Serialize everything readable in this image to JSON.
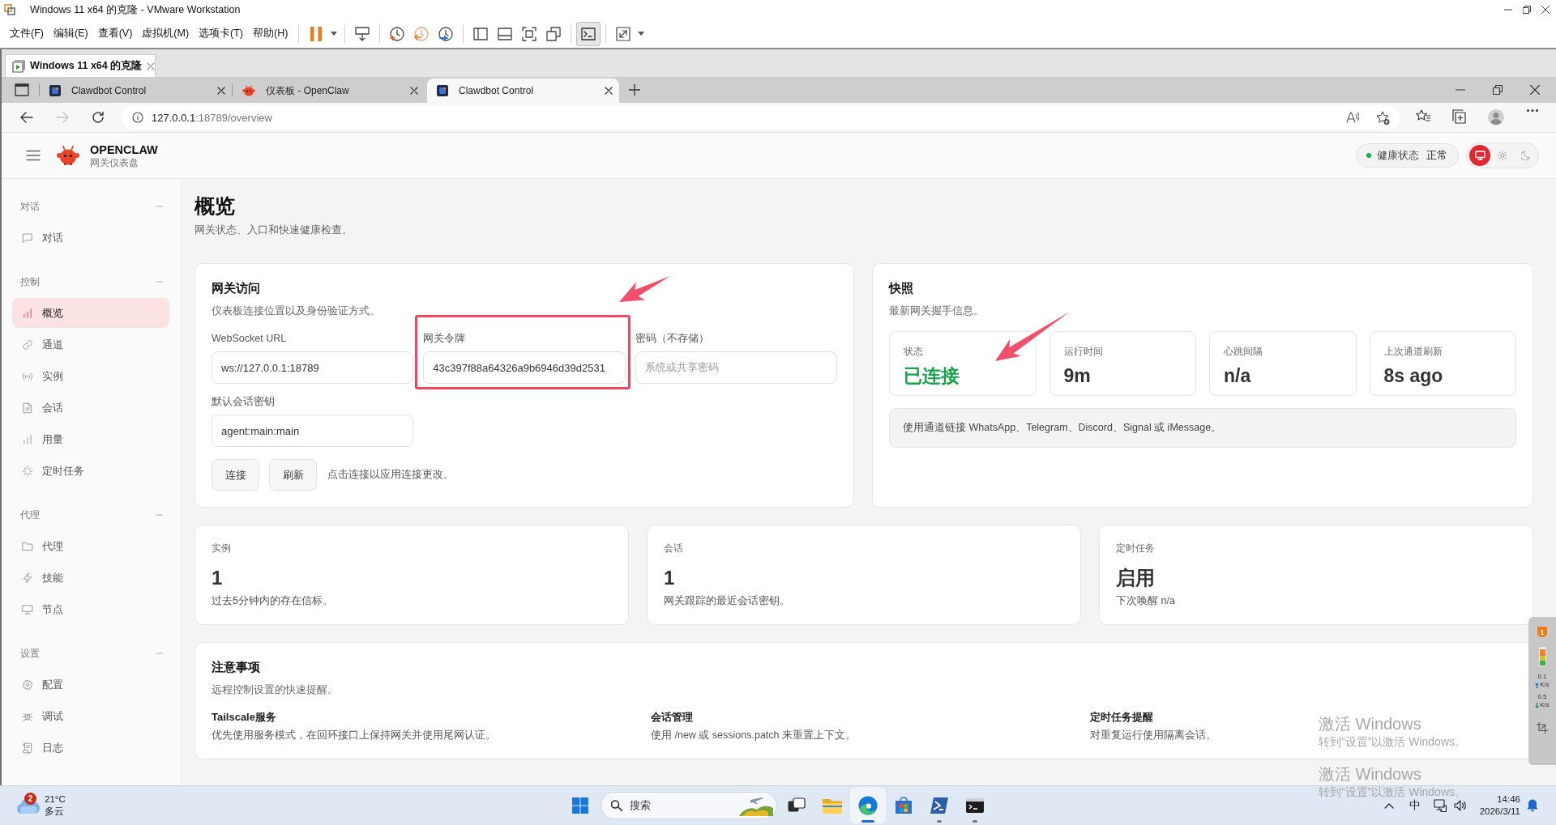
{
  "vmware": {
    "title": "Windows 11 x64 的克隆 - VMware Workstation",
    "menu": [
      "文件(F)",
      "编辑(E)",
      "查看(V)",
      "虚拟机(M)",
      "选项卡(T)",
      "帮助(H)"
    ],
    "console_pressed": true,
    "tabs": [
      {
        "label": "Windows 11 x64 的克隆",
        "selected": true
      }
    ]
  },
  "browser": {
    "tabs": [
      {
        "label": "Clawdbot Control",
        "kind": "tile",
        "selected": false
      },
      {
        "label": "仪表板 - OpenClaw",
        "kind": "mascot",
        "selected": false
      },
      {
        "label": "Clawdbot Control",
        "kind": "tile",
        "selected": true
      }
    ],
    "nav_buttons": [
      {
        "kind": "back",
        "disabled": false
      },
      {
        "kind": "forward",
        "disabled": true
      },
      {
        "kind": "refresh",
        "disabled": false
      }
    ],
    "address": {
      "host": "127.0.0.1",
      "path": ":18789/overview"
    }
  },
  "header": {
    "brand": "OPENCLAW",
    "subtitle": "网关仪表盘",
    "health": {
      "label": "健康状态",
      "value": "正常",
      "ok": true
    },
    "theme_modes": [
      {
        "kind": "system",
        "selected": true
      },
      {
        "kind": "light",
        "selected": false
      },
      {
        "kind": "dark",
        "selected": false
      }
    ]
  },
  "sidebar": {
    "sections": [
      {
        "title": "对话",
        "expanded": true,
        "items": [
          {
            "label": "对话",
            "selected": false
          }
        ]
      },
      {
        "title": "控制",
        "expanded": true,
        "items": [
          {
            "label": "概览",
            "selected": true
          },
          {
            "label": "通道",
            "selected": false
          },
          {
            "label": "实例",
            "selected": false
          },
          {
            "label": "会话",
            "selected": false
          },
          {
            "label": "用量",
            "selected": false
          },
          {
            "label": "定时任务",
            "selected": false
          }
        ]
      },
      {
        "title": "代理",
        "expanded": true,
        "items": [
          {
            "label": "代理",
            "selected": false
          },
          {
            "label": "技能",
            "selected": false
          },
          {
            "label": "节点",
            "selected": false
          }
        ]
      },
      {
        "title": "设置",
        "expanded": true,
        "items": [
          {
            "label": "配置",
            "selected": false
          },
          {
            "label": "调试",
            "selected": false
          },
          {
            "label": "日志",
            "selected": false
          }
        ]
      }
    ]
  },
  "page": {
    "title": "概览",
    "subtitle": "网关状态、入口和快速健康检查。"
  },
  "gateway_access": {
    "title": "网关访问",
    "description": "仪表板连接位置以及身份验证方式。",
    "fields": [
      {
        "label": "WebSocket URL",
        "value": "ws://127.0.0.1:18789",
        "highlighted": false,
        "arrow": false
      },
      {
        "label": "网关令牌",
        "value": "43c397f88a64326a9b6946d39d2531",
        "highlighted": true,
        "arrow": true
      },
      {
        "label": "密码（不存储）",
        "placeholder": "系统或共享密码",
        "highlighted": false,
        "arrow": false
      },
      {
        "label": "默认会话密钥",
        "value": "agent:main:main",
        "highlighted": false,
        "arrow": false
      }
    ],
    "buttons": [
      "连接",
      "刷新"
    ],
    "hint": "点击连接以应用连接更改。"
  },
  "snapshot": {
    "title": "快照",
    "description": "最新网关握手信息。",
    "stats": [
      {
        "kind": "status",
        "label": "状态",
        "value": "已连接",
        "arrow": true
      },
      {
        "kind": "metric",
        "label": "运行时间",
        "value": "9m",
        "arrow": false
      },
      {
        "kind": "metric",
        "label": "心跳间隔",
        "value": "n/a",
        "arrow": false
      },
      {
        "kind": "metric",
        "label": "上次通道刷新",
        "value": "8s ago",
        "arrow": false
      }
    ],
    "note": "使用通道链接 WhatsApp、Telegram、Discord、Signal 或 iMessage。"
  },
  "summary_cards": [
    {
      "label": "实例",
      "value": "1",
      "detail": "过去5分钟内的存在信标。"
    },
    {
      "label": "会话",
      "value": "1",
      "detail": "网关跟踪的最近会话密钥。"
    },
    {
      "label": "定时任务",
      "value": "启用",
      "detail": "下次唤醒 n/a"
    }
  ],
  "notes": {
    "title": "注意事项",
    "description": "远程控制设置的快速提醒。",
    "items": [
      {
        "title": "Tailscale服务",
        "text": "优先使用服务模式，在回环接口上保持网关并使用尾网认证。"
      },
      {
        "title": "会话管理",
        "text": "使用 /new 或 sessions.patch 来重置上下文。"
      },
      {
        "title": "定时任务提醒",
        "text": "对重复运行使用隔离会话。"
      }
    ]
  },
  "network_monitor": {
    "badge": "1",
    "upload": "0.1",
    "upload_unit": "K/s",
    "download": "0.5",
    "download_unit": "K/s"
  },
  "activation_notices": [
    {
      "title": "激活 Windows",
      "text": "转到“设置”以激活 Windows。"
    },
    {
      "title": "激活 Windows",
      "text": "转到“设置”以激活 Windows。"
    }
  ],
  "taskbar": {
    "weather": {
      "badge": "2",
      "temperature": "21°C",
      "condition": "多云"
    },
    "search": {
      "placeholder": "搜索"
    },
    "apps": [
      {
        "running": false,
        "selected": false
      },
      {
        "running": false,
        "selected": false
      },
      {
        "running": true,
        "selected": true
      },
      {
        "running": false,
        "selected": false
      },
      {
        "running": true,
        "selected": false
      },
      {
        "running": true,
        "selected": false
      }
    ],
    "ime": "中",
    "time": "14:46",
    "date": "2026/3/11"
  }
}
